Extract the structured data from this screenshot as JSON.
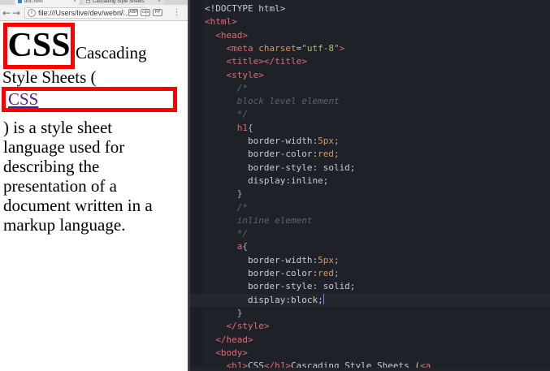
{
  "browser": {
    "tabs": [
      {
        "label": "doc.html",
        "close": "×",
        "active": true
      },
      {
        "label": "Cascading Style Sheets",
        "close": "×",
        "active": false
      }
    ],
    "toolbar": {
      "back_icon": "←",
      "forward_icon": "→",
      "reload_icon": "↻",
      "info_icon": "i",
      "url": "file:///Users/live/dev/webn/...",
      "star_icon": "☆",
      "extensions": [
        "ABP",
        "ces",
        "FP"
      ],
      "menu_icon": "⋮"
    },
    "page": {
      "h1": "CSS",
      "text_after_h1": "Cascading",
      "text_line2": "Style Sheets (",
      "link": "CSS",
      "paragraph_lines": [
        ") is a style sheet",
        "language used for",
        "describing the",
        "presentation of a",
        "document written in a",
        "markup language."
      ]
    }
  },
  "editor": {
    "lines": [
      [
        {
          "t": "text",
          "v": "<!DOCTYPE html>"
        }
      ],
      [
        {
          "t": "tag",
          "v": "<html>"
        }
      ],
      [
        {
          "t": "text",
          "v": "  "
        },
        {
          "t": "tag",
          "v": "<head>"
        }
      ],
      [
        {
          "t": "text",
          "v": "    "
        },
        {
          "t": "tag",
          "v": "<meta "
        },
        {
          "t": "attr",
          "v": "charset"
        },
        {
          "t": "text",
          "v": "="
        },
        {
          "t": "string",
          "v": "\"utf-8\""
        },
        {
          "t": "tag",
          "v": ">"
        }
      ],
      [
        {
          "t": "text",
          "v": "    "
        },
        {
          "t": "tag",
          "v": "<title></title>"
        }
      ],
      [
        {
          "t": "text",
          "v": "    "
        },
        {
          "t": "tag",
          "v": "<style>"
        }
      ],
      [
        {
          "t": "comment",
          "v": "      /*"
        }
      ],
      [
        {
          "t": "comment",
          "v": "      block level element"
        }
      ],
      [
        {
          "t": "comment",
          "v": "      */"
        }
      ],
      [
        {
          "t": "text",
          "v": "      "
        },
        {
          "t": "sel",
          "v": "h1"
        },
        {
          "t": "punc",
          "v": "{"
        }
      ],
      [
        {
          "t": "prop",
          "v": "        border-width:"
        },
        {
          "t": "num",
          "v": "5px"
        },
        {
          "t": "punc",
          "v": ";"
        }
      ],
      [
        {
          "t": "prop",
          "v": "        border-color:"
        },
        {
          "t": "num",
          "v": "red"
        },
        {
          "t": "punc",
          "v": ";"
        }
      ],
      [
        {
          "t": "prop",
          "v": "        border-style: solid;"
        }
      ],
      [
        {
          "t": "prop",
          "v": "        display:inline;"
        }
      ],
      [
        {
          "t": "punc",
          "v": "      }"
        }
      ],
      [
        {
          "t": "comment",
          "v": "      /*"
        }
      ],
      [
        {
          "t": "comment",
          "v": "      inline element"
        }
      ],
      [
        {
          "t": "comment",
          "v": "      */"
        }
      ],
      [
        {
          "t": "text",
          "v": "      "
        },
        {
          "t": "sel",
          "v": "a"
        },
        {
          "t": "punc",
          "v": "{"
        }
      ],
      [
        {
          "t": "prop",
          "v": "        border-width:"
        },
        {
          "t": "num",
          "v": "5px"
        },
        {
          "t": "punc",
          "v": ";"
        }
      ],
      [
        {
          "t": "prop",
          "v": "        border-color:"
        },
        {
          "t": "num",
          "v": "red"
        },
        {
          "t": "punc",
          "v": ";"
        }
      ],
      [
        {
          "t": "prop",
          "v": "        border-style: solid;"
        }
      ],
      [
        {
          "t": "prop",
          "v": "        display:block;"
        },
        {
          "t": "cursor",
          "v": ""
        }
      ],
      [
        {
          "t": "punc",
          "v": "      }"
        }
      ],
      [
        {
          "t": "text",
          "v": "    "
        },
        {
          "t": "tag",
          "v": "</style>"
        }
      ],
      [
        {
          "t": "text",
          "v": "  "
        },
        {
          "t": "tag",
          "v": "</head>"
        }
      ],
      [
        {
          "t": "text",
          "v": "  "
        },
        {
          "t": "tag",
          "v": "<body>"
        }
      ],
      [
        {
          "t": "text",
          "v": "    "
        },
        {
          "t": "tag",
          "v": "<h1>"
        },
        {
          "t": "text",
          "v": "CSS"
        },
        {
          "t": "tag",
          "v": "</h1>"
        },
        {
          "t": "text",
          "v": "Cascading Style Sheets ("
        },
        {
          "t": "tag",
          "v": "<a"
        }
      ]
    ],
    "active_line": 22
  }
}
